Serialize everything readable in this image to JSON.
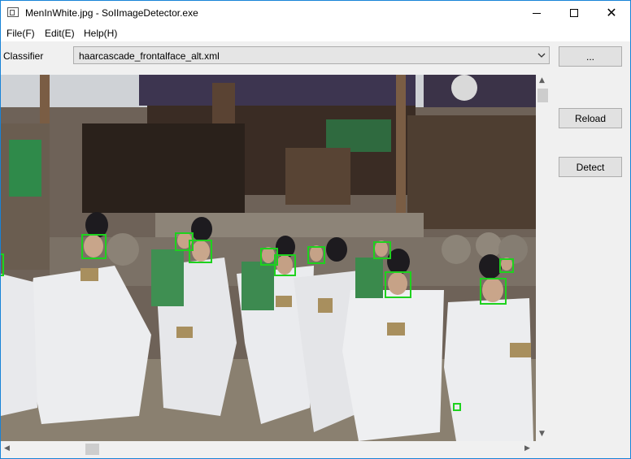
{
  "window": {
    "title": "MenInWhite.jpg - SoIImageDetector.exe",
    "minimize_glyph": "—",
    "maximize_glyph": "☐",
    "close_glyph": "✕"
  },
  "menu": {
    "items": [
      {
        "label": "File(F)"
      },
      {
        "label": "Edit(E)"
      },
      {
        "label": "Help(H)"
      }
    ]
  },
  "classifier": {
    "label": "Classifier",
    "selected": "haarcascade_frontalface_alt.xml"
  },
  "buttons": {
    "browse": "...",
    "reload": "Reload",
    "detect": "Detect"
  },
  "colors": {
    "detection_box": "#1ed21e",
    "window_border": "#1883d7"
  },
  "icons": {
    "app": "app-window-icon",
    "combo": "chevron-down-icon",
    "scroll_up": "chevron-up-icon",
    "scroll_down": "chevron-down-icon",
    "scroll_left": "chevron-left-icon",
    "scroll_right": "chevron-right-icon"
  }
}
